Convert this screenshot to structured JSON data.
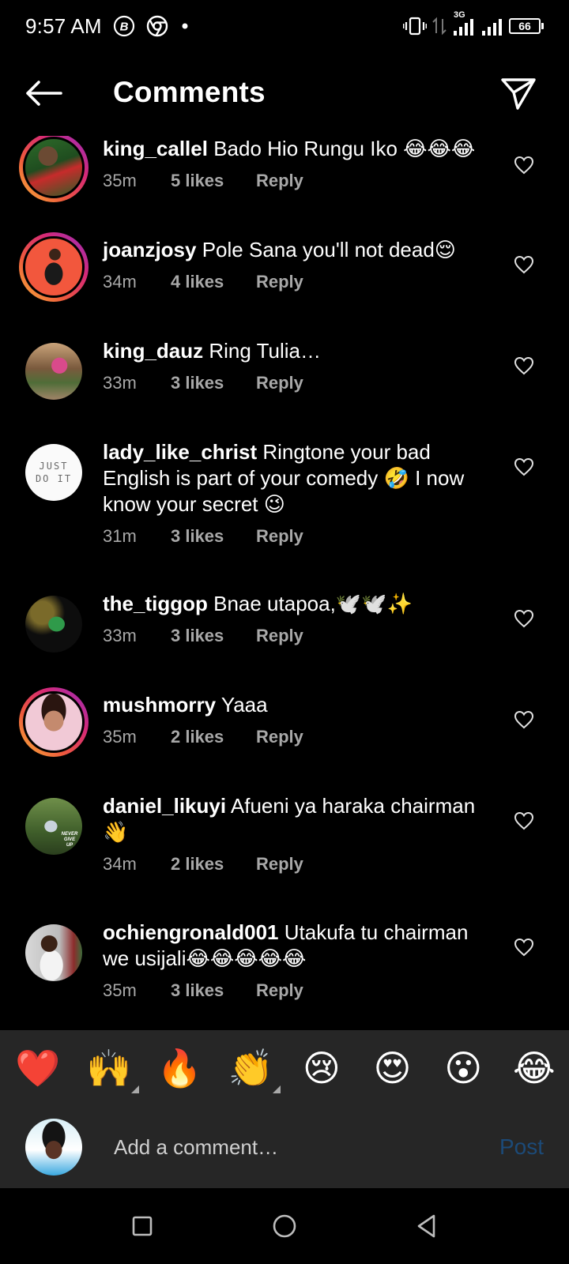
{
  "status_bar": {
    "time": "9:57 AM",
    "network": "3G",
    "battery": "66",
    "icons": [
      "b-badge-icon",
      "chrome-icon",
      "notification-dot-icon",
      "vibrate-icon",
      "data-arrows-icon",
      "signal-icon",
      "signal-icon-2",
      "battery-icon"
    ]
  },
  "header": {
    "title": "Comments",
    "back_icon": "arrow-left-icon",
    "send_icon": "paper-plane-icon"
  },
  "comments": [
    {
      "user": "king_callel",
      "text": "Bado Hio Rungu Iko 😂😂😂",
      "time": "35m",
      "likes": "5 likes",
      "reply": "Reply",
      "story_ring": true
    },
    {
      "user": "joanzjosy",
      "text": "Pole Sana you'll not dead😌",
      "time": "34m",
      "likes": "4 likes",
      "reply": "Reply",
      "story_ring": true
    },
    {
      "user": "king_dauz",
      "text": "Ring Tulia…",
      "time": "33m",
      "likes": "3 likes",
      "reply": "Reply",
      "story_ring": false
    },
    {
      "user": "lady_like_christ",
      "text": "Ringtone your bad English is part of your comedy 🤣 I now know your secret 😉",
      "time": "31m",
      "likes": "3 likes",
      "reply": "Reply",
      "story_ring": false
    },
    {
      "user": "the_tiggop",
      "text": "Bnae utapoa,🕊️🕊️✨",
      "time": "33m",
      "likes": "3 likes",
      "reply": "Reply",
      "story_ring": false
    },
    {
      "user": "mushmorry",
      "text": "Yaaa",
      "time": "35m",
      "likes": "2 likes",
      "reply": "Reply",
      "story_ring": true
    },
    {
      "user": "daniel_likuyi",
      "text": "Afueni ya haraka chairman 👋",
      "time": "34m",
      "likes": "2 likes",
      "reply": "Reply",
      "story_ring": false
    },
    {
      "user": "ochiengronald001",
      "text": "Utakufa tu chairman we usijali😂😂😂😂😂",
      "time": "35m",
      "likes": "3 likes",
      "reply": "Reply",
      "story_ring": false
    }
  ],
  "avatar_labels": {
    "just_do_it_line1": "JUST",
    "just_do_it_line2": "DO IT",
    "never_give_up": "NEVER GIVE UP"
  },
  "reactions": [
    "❤️",
    "🙌",
    "🔥",
    "👏",
    "😢",
    "😍",
    "😮",
    "😂"
  ],
  "composer": {
    "placeholder": "Add a comment…",
    "post_label": "Post"
  },
  "colors": {
    "background": "#000000",
    "secondary_text": "#a8a8a8",
    "panel": "#262626",
    "post_disabled": "#1c4a78"
  }
}
